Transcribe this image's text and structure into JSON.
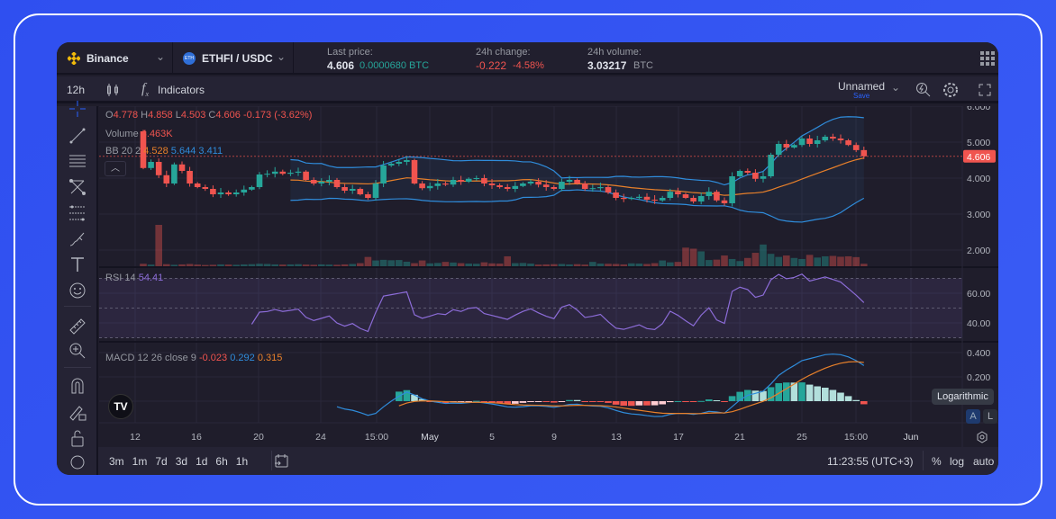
{
  "header": {
    "exchange": "Binance",
    "pair": "ETHFI / USDC",
    "pair_icon_text": "ETH",
    "last_price_label": "Last price:",
    "last_price": "4.606",
    "last_price_btc": "0.0000680 BTC",
    "change_label": "24h change:",
    "change_abs": "-0.222",
    "change_pct": "-4.58%",
    "volume_label": "24h volume:",
    "volume": "3.03217",
    "volume_unit": "BTC"
  },
  "toolbar": {
    "interval": "12h",
    "indicators": "Indicators",
    "layout_name": "Unnamed",
    "save": "Save"
  },
  "legend": {
    "o_label": "O",
    "o": "4.778",
    "h_label": "H",
    "h": "4.858",
    "l_label": "L",
    "l": "4.503",
    "c_label": "C",
    "c": "4.606",
    "change": "-0.173 (-3.62%)",
    "volume_label": "Volume",
    "volume": "4.463K",
    "bb_label": "BB 20 2",
    "bb_mid": "4.528",
    "bb_up": "5.644",
    "bb_low": "3.411",
    "rsi_label": "RSI 14",
    "rsi": "54.41",
    "macd_label": "MACD 12 26 close 9",
    "macd_hist": "-0.023",
    "macd_line": "0.292",
    "macd_signal": "0.315"
  },
  "price_axis": {
    "ticks": [
      "6.000",
      "5.000",
      "4.000",
      "3.000",
      "2.000"
    ],
    "last": "4.606",
    "rsi_ticks": [
      "60.00",
      "40.00"
    ],
    "macd_ticks": [
      "0.400",
      "0.200"
    ]
  },
  "time_axis": [
    "12",
    "16",
    "20",
    "24",
    "15:00",
    "May",
    "5",
    "9",
    "13",
    "17",
    "21",
    "25",
    "15:00",
    "Jun"
  ],
  "tooltip": "Logarithmic",
  "scale_buttons": {
    "auto": "A",
    "log": "L"
  },
  "bottom": {
    "ranges": [
      "3m",
      "1m",
      "7d",
      "3d",
      "1d",
      "6h",
      "1h"
    ],
    "clock": "11:23:55 (UTC+3)",
    "percent": "%",
    "log": "log",
    "auto": "auto"
  },
  "colors": {
    "up": "#26a69a",
    "down": "#f0544f",
    "bb_band": "#2f8cdb",
    "bb_basis": "#e8802a",
    "rsi": "#8c6cd8",
    "macd": "#2f8cdb",
    "signal": "#e8802a",
    "accent": "#2962ff"
  },
  "chart_data": {
    "type": "candlestick",
    "price_range": [
      1.6,
      6.0
    ],
    "closes": [
      4.28,
      4.45,
      4.08,
      3.85,
      4.38,
      4.2,
      3.85,
      3.75,
      3.7,
      3.55,
      3.6,
      3.55,
      3.6,
      3.68,
      3.75,
      4.1,
      4.12,
      4.18,
      4.12,
      4.15,
      4.18,
      3.95,
      3.85,
      3.9,
      3.95,
      3.75,
      3.65,
      3.7,
      3.55,
      3.45,
      3.85,
      4.35,
      4.4,
      4.45,
      4.5,
      3.85,
      3.72,
      3.78,
      3.85,
      3.82,
      3.95,
      3.9,
      3.98,
      4.0,
      3.85,
      3.8,
      3.75,
      3.7,
      3.78,
      3.85,
      3.9,
      3.82,
      3.75,
      3.7,
      3.9,
      3.95,
      3.85,
      3.7,
      3.72,
      3.75,
      3.6,
      3.45,
      3.42,
      3.45,
      3.48,
      3.4,
      3.38,
      3.45,
      3.62,
      3.55,
      3.45,
      3.35,
      3.5,
      3.62,
      3.38,
      3.3,
      4.05,
      4.2,
      4.15,
      3.98,
      4.05,
      4.65,
      4.95,
      4.85,
      4.92,
      5.1,
      4.95,
      5.05,
      5.15,
      5.1,
      5.05,
      4.92,
      4.778,
      4.606
    ],
    "first_open": 5.3,
    "volumes_k": [
      1.2,
      0.8,
      20,
      1.0,
      0.7,
      0.9,
      1.1,
      0.8,
      0.6,
      0.7,
      0.9,
      0.8,
      0.7,
      0.9,
      1.0,
      1.2,
      1.1,
      0.9,
      0.8,
      0.9,
      1.0,
      0.8,
      0.7,
      0.9,
      0.8,
      0.7,
      0.9,
      1.1,
      1.5,
      4.5,
      2.8,
      3.1,
      2.9,
      3.0,
      2.2,
      1.5,
      2.8,
      1.4,
      1.6,
      2.1,
      1.8,
      1.5,
      1.3,
      1.2,
      1.9,
      1.4,
      1.3,
      4.8,
      1.5,
      1.6,
      1.3,
      0.8,
      0.9,
      1.0,
      1.1,
      0.9,
      1.0,
      0.8,
      2.1,
      1.3,
      1.2,
      1.1,
      0.9,
      1.4,
      1.3,
      1.1,
      1.5,
      2.8,
      1.9,
      2.1,
      9.0,
      8.5,
      7.2,
      3.0,
      3.2,
      5.2,
      3.5,
      2.5,
      4.0,
      6.5,
      10.5,
      6.0,
      4.5,
      5.2,
      4.0,
      3.5,
      5.5,
      4.2,
      4.8,
      5.0,
      4.6,
      4.8,
      4.4,
      1.2
    ]
  }
}
